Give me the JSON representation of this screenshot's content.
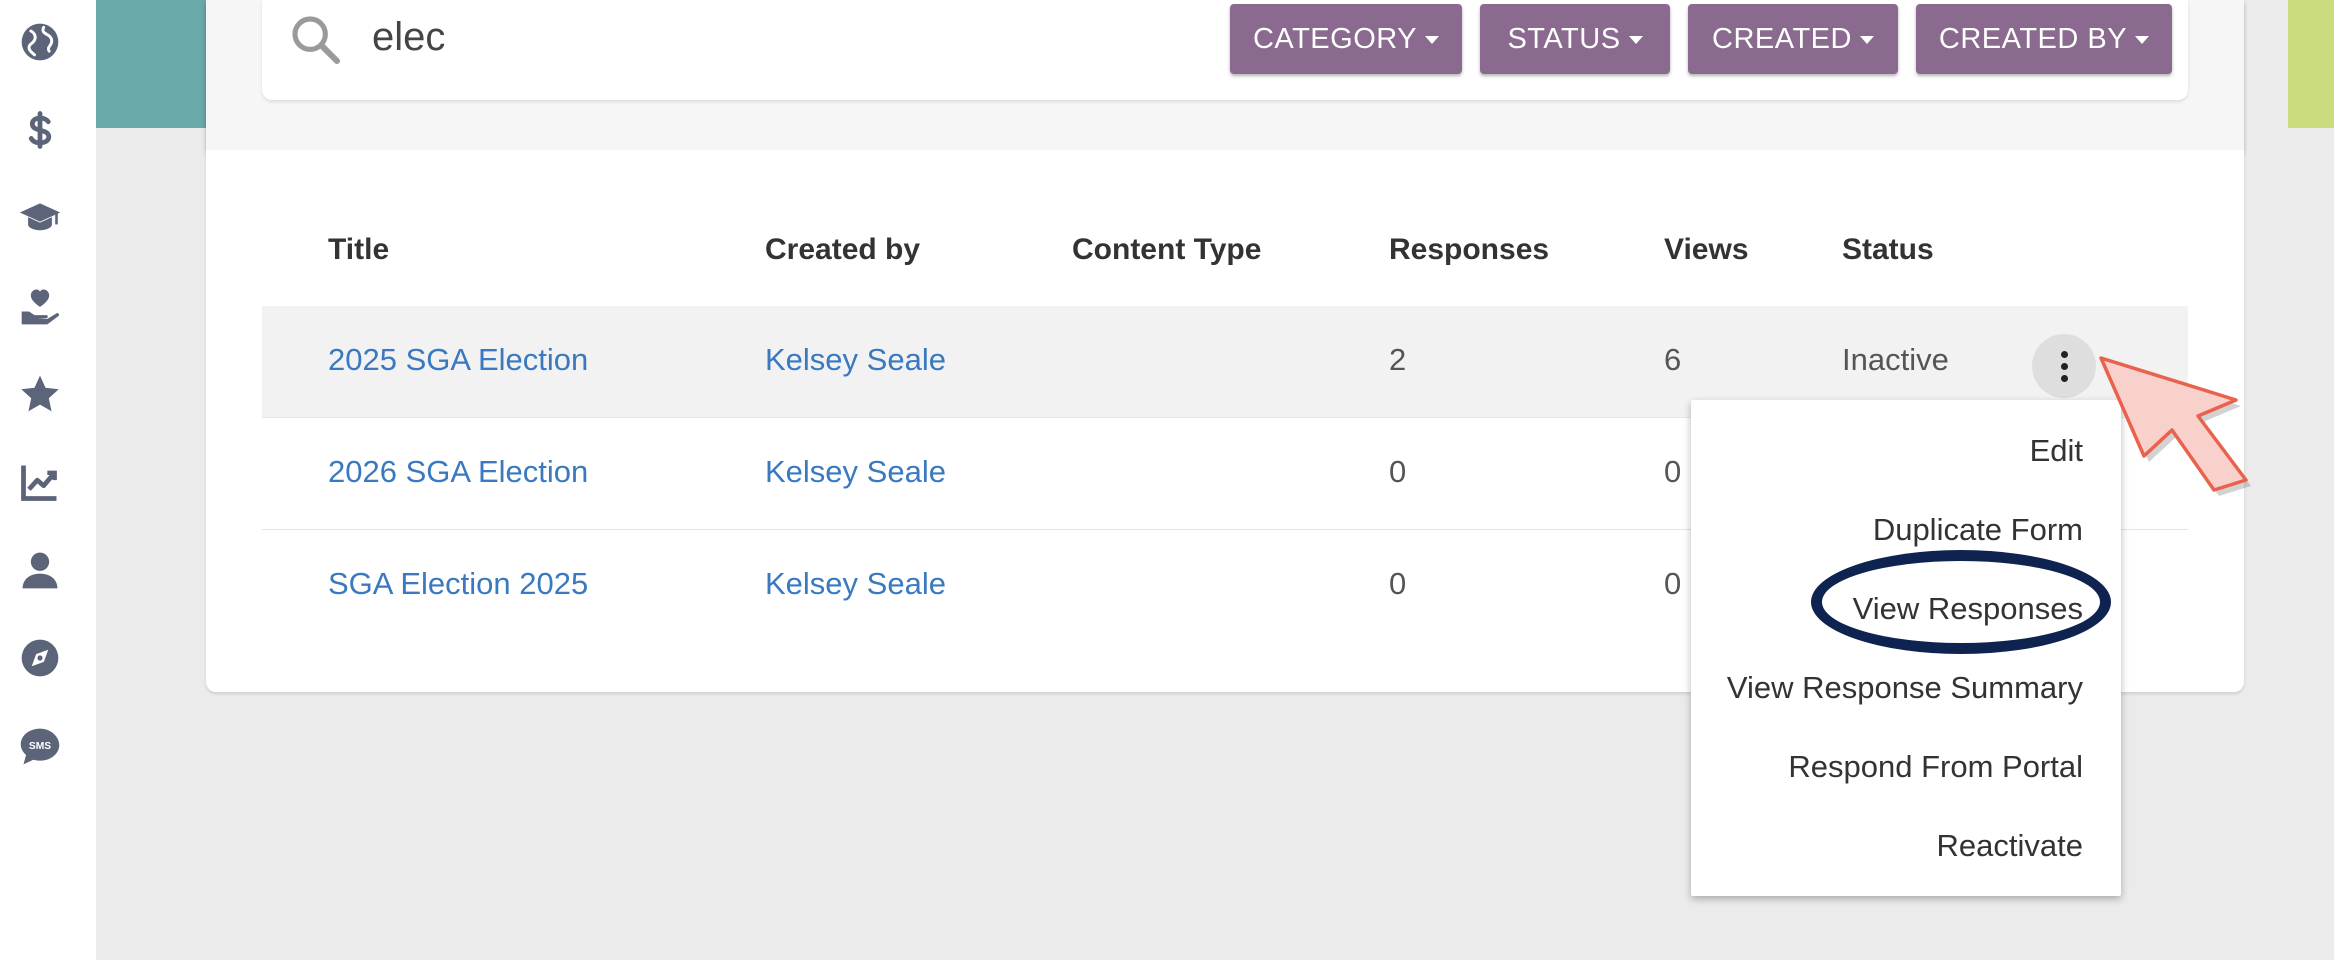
{
  "sidebar": {
    "items": [
      {
        "name": "globe-icon"
      },
      {
        "name": "dollar-icon"
      },
      {
        "name": "graduation-cap-icon"
      },
      {
        "name": "hand-heart-icon"
      },
      {
        "name": "star-icon"
      },
      {
        "name": "chart-line-icon"
      },
      {
        "name": "user-icon"
      },
      {
        "name": "compass-icon"
      },
      {
        "name": "sms-icon",
        "label": "SMS"
      }
    ]
  },
  "search": {
    "value": "elec",
    "placeholder": ""
  },
  "filters": [
    {
      "label": "CATEGORY"
    },
    {
      "label": "STATUS"
    },
    {
      "label": "CREATED"
    },
    {
      "label": "CREATED BY"
    }
  ],
  "table": {
    "headers": [
      "Title",
      "Created by",
      "Content Type",
      "Responses",
      "Views",
      "Status"
    ],
    "rows": [
      {
        "title": "2025 SGA Election",
        "created_by": "Kelsey Seale",
        "content_type": "",
        "responses": "2",
        "views": "6",
        "status": "Inactive"
      },
      {
        "title": "2026 SGA Election",
        "created_by": "Kelsey Seale",
        "content_type": "",
        "responses": "0",
        "views": "0",
        "status": ""
      },
      {
        "title": "SGA Election 2025",
        "created_by": "Kelsey Seale",
        "content_type": "",
        "responses": "0",
        "views": "0",
        "status": ""
      }
    ]
  },
  "menu": {
    "items": [
      "Edit",
      "Duplicate Form",
      "View Responses",
      "View Response Summary",
      "Respond From Portal",
      "Reactivate"
    ],
    "highlighted": "View Responses"
  },
  "colors": {
    "filter_button": "#8b6a8f",
    "link": "#3a79c0",
    "highlight_ring": "#0f2350",
    "pointer_fill": "#f9d1cc",
    "pointer_stroke": "#e8624d",
    "banner_left": "#6aa8a9",
    "banner_right": "#c9dc7e"
  }
}
